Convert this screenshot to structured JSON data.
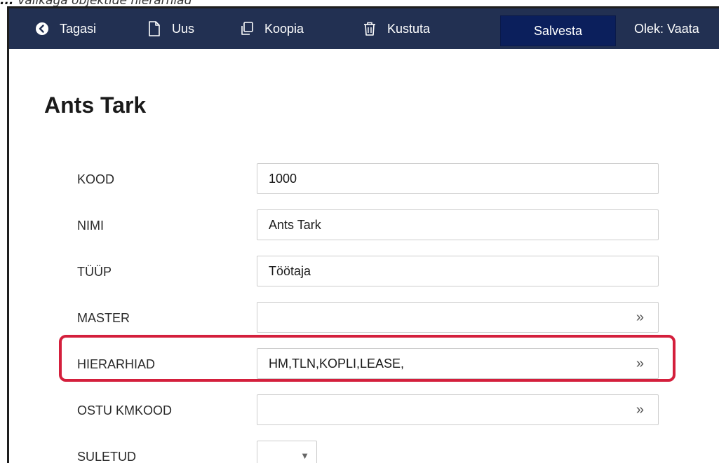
{
  "caption": {
    "lead": "...",
    "text": "Valikaga objektide hierarhiad"
  },
  "toolbar": {
    "back_label": "Tagasi",
    "new_label": "Uus",
    "copy_label": "Koopia",
    "delete_label": "Kustuta",
    "save_label": "Salvesta",
    "status_label": "Olek: Vaata"
  },
  "page": {
    "title": "Ants Tark"
  },
  "form": {
    "kood": {
      "label": "KOOD",
      "value": "1000"
    },
    "nimi": {
      "label": "NIMI",
      "value": "Ants Tark"
    },
    "tyyp": {
      "label": "TÜÜP",
      "value": "Töötaja"
    },
    "master": {
      "label": "MASTER",
      "value": ""
    },
    "hierarhiad": {
      "label": "HIERARHIAD",
      "value": "HM,TLN,KOPLI,LEASE,"
    },
    "ostu_kmkood": {
      "label": "OSTU KMKOOD",
      "value": ""
    },
    "suletud": {
      "label": "SULETUD",
      "value": ""
    }
  },
  "icons": {
    "back": "arrow-left-circle-icon",
    "new": "file-icon",
    "copy": "copy-icon",
    "delete": "trash-icon",
    "lookup": "double-chevron-right-icon",
    "dropdown": "caret-down-icon"
  },
  "colors": {
    "toolbar_bg": "#223052",
    "save_bg": "#0b1f5c",
    "highlight": "#d41f3c"
  }
}
